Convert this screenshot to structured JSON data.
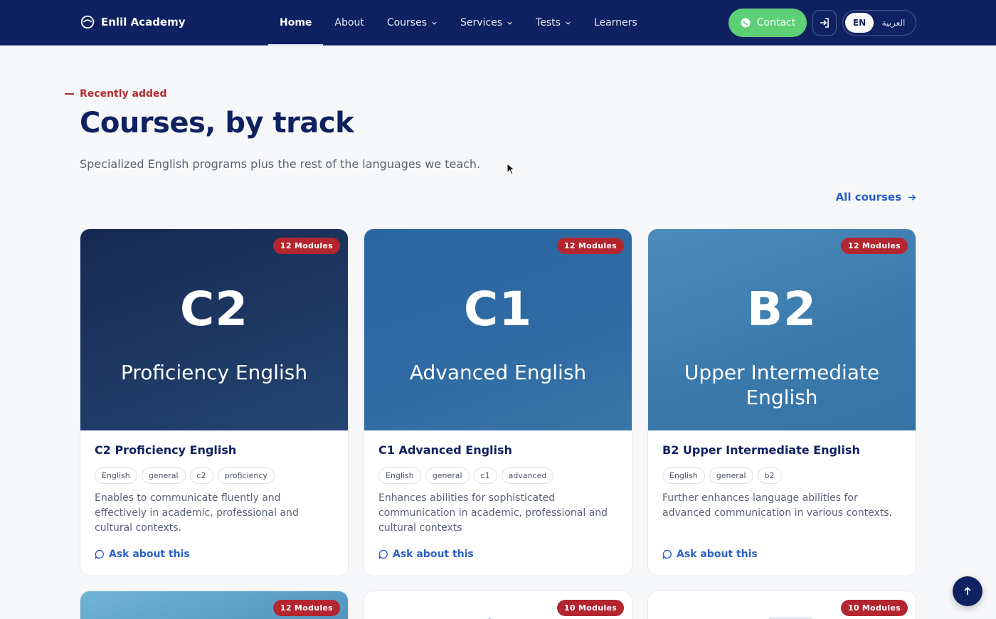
{
  "nav": {
    "brand": "Enlil Academy",
    "items": [
      {
        "label": "Home",
        "active": true,
        "dropdown": false
      },
      {
        "label": "About",
        "active": false,
        "dropdown": false
      },
      {
        "label": "Courses",
        "active": false,
        "dropdown": true
      },
      {
        "label": "Services",
        "active": false,
        "dropdown": true
      },
      {
        "label": "Tests",
        "active": false,
        "dropdown": true
      },
      {
        "label": "Learners",
        "active": false,
        "dropdown": false
      }
    ],
    "contact_label": "Contact",
    "lang_en": "EN",
    "lang_ar": "العربية"
  },
  "section": {
    "eyebrow": "Recently added",
    "title": "Courses, by track",
    "subtitle": "Specialized English programs plus the rest of the languages we teach.",
    "all_link": "All courses"
  },
  "courses": [
    {
      "code": "C2",
      "hero_title": "Proficiency English",
      "badge": "12 Modules",
      "title": "C2 Proficiency English",
      "tags": [
        "English",
        "general",
        "c2",
        "proficiency"
      ],
      "description": "Enables to communicate fluently and effectively in academic, professional and cultural contexts.",
      "ask": "Ask about this"
    },
    {
      "code": "C1",
      "hero_title": "Advanced English",
      "badge": "12 Modules",
      "title": "C1 Advanced English",
      "tags": [
        "English",
        "general",
        "c1",
        "advanced"
      ],
      "description": "Enhances abilities for sophisticated communication in academic, professional and cultural contexts",
      "ask": "Ask about this"
    },
    {
      "code": "B2",
      "hero_title": "Upper Intermediate English",
      "badge": "12 Modules",
      "title": "B2 Upper Intermediate English",
      "tags": [
        "English",
        "general",
        "b2"
      ],
      "description": "Further enhances language abilities for advanced communication in various contexts.",
      "ask": "Ask about this"
    }
  ],
  "partial_badges": [
    "12 Modules",
    "10 Modules",
    "10 Modules"
  ],
  "colors": {
    "navy": "#0f2160",
    "accent_red": "#b3262f",
    "link_blue": "#2c60c9",
    "contact_green": "#5ccf77"
  }
}
